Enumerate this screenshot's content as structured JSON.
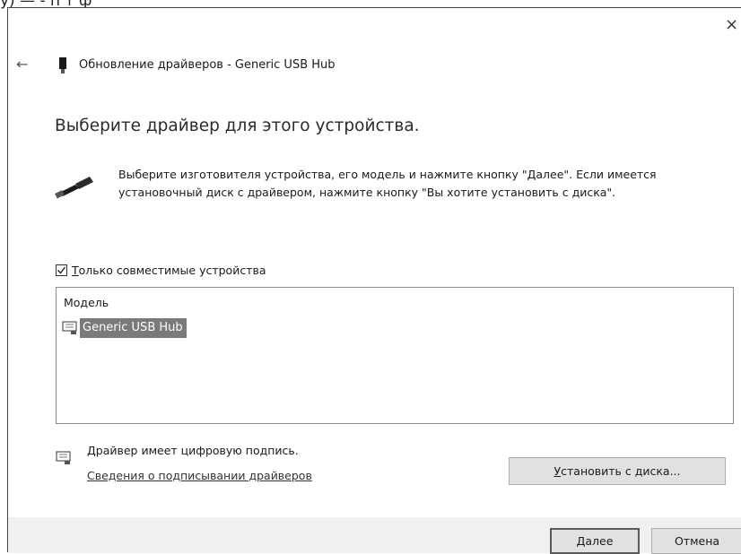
{
  "background_text": "у) — - п т ф",
  "window": {
    "close_glyph": "×",
    "back_glyph": "←",
    "title": "Обновление драйверов - Generic USB Hub"
  },
  "main": {
    "heading": "Выберите драйвер для этого устройства.",
    "instructions": "Выберите изготовителя устройства, его модель и нажмите кнопку \"Далее\". Если имеется установочный диск с  драйвером, нажмите кнопку \"Вы хотите установить с диска\".",
    "compatible_checkbox": {
      "accel": "Т",
      "label_rest": "олько совместимые устройства",
      "checked": true
    },
    "model_list": {
      "header": "Модель",
      "items": [
        {
          "label": "Generic USB Hub",
          "selected": true
        }
      ]
    },
    "signature": {
      "text": "Драйвер имеет цифровую подпись.",
      "link": "Сведения о подписывании драйверов"
    },
    "have_disk_button": {
      "accel": "У",
      "label_rest": "становить с диска..."
    }
  },
  "footer": {
    "next_button": {
      "accel": "Д",
      "label_rest": "алее"
    },
    "cancel_button": "Отмена"
  },
  "colors": {
    "selection": "#7a7a7a",
    "button_face": "#e1e1e1",
    "footer_bg": "#f0f0f0"
  }
}
